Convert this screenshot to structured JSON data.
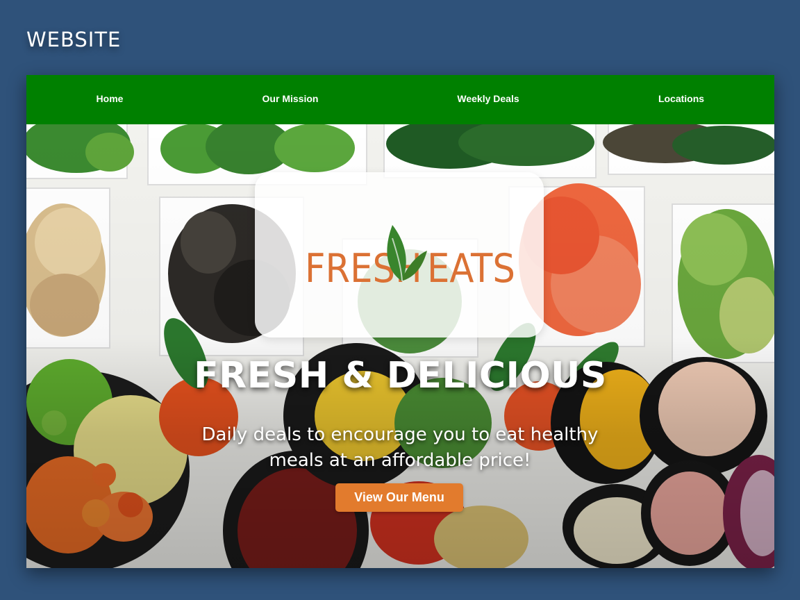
{
  "page_label": "WEBSITE",
  "nav": {
    "items": [
      {
        "label": "Home"
      },
      {
        "label": "Our Mission"
      },
      {
        "label": "Weekly Deals"
      },
      {
        "label": "Locations"
      }
    ]
  },
  "hero": {
    "logo_text_left": "FRESH",
    "logo_text_right": "EATS",
    "title": "FRESH & DELICIOUS",
    "subtitle": "Daily deals to encourage you to eat healthy meals at an affordable price!",
    "button_label": "View Our Menu"
  },
  "colors": {
    "background": "#2f527a",
    "nav_green": "#008000",
    "accent_orange": "#e27b2d",
    "logo_orange": "#db7134",
    "leaf_green": "#39852d"
  },
  "icons": {
    "logo_leaf": "leaf-icon"
  }
}
